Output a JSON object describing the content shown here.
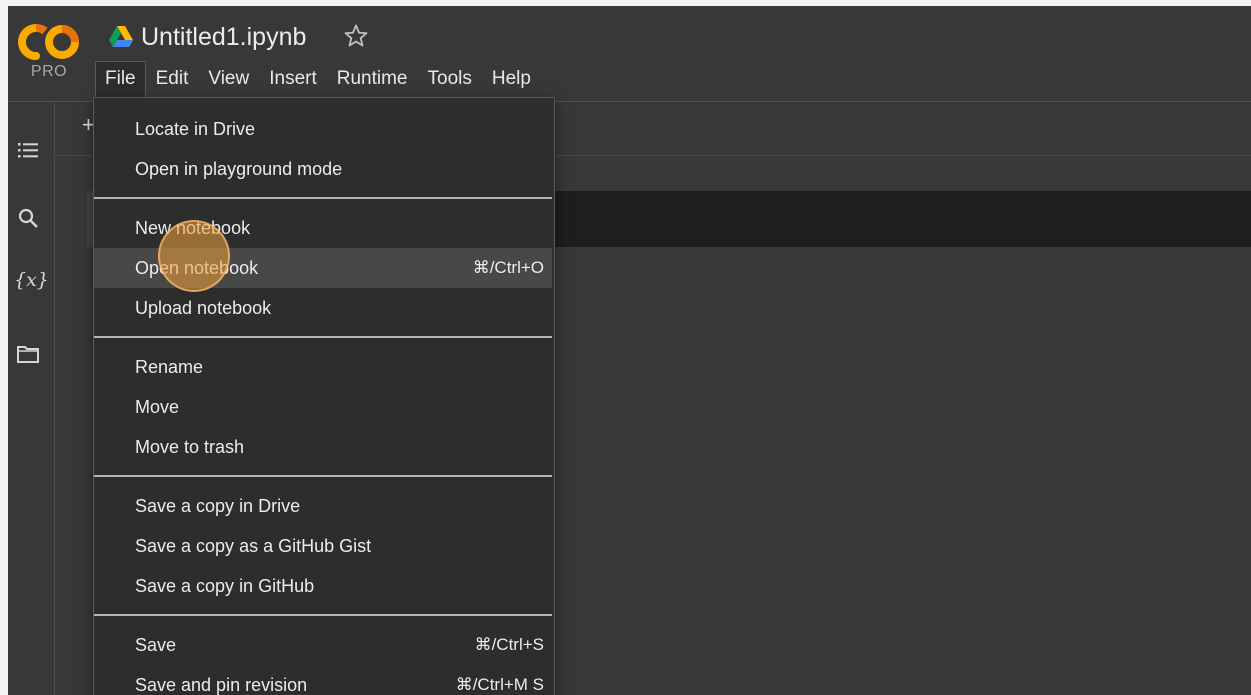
{
  "app": {
    "logo_text": "CO",
    "tier_badge": "PRO",
    "notebook_title": "Untitled1.ipynb"
  },
  "menubar": {
    "items": [
      "File",
      "Edit",
      "View",
      "Insert",
      "Runtime",
      "Tools",
      "Help"
    ],
    "active": "File"
  },
  "rail": {
    "variables_label": "{x}"
  },
  "toolbar": {
    "add_label": "+"
  },
  "file_menu": {
    "groups": [
      [
        {
          "label": "Locate in Drive",
          "shortcut": ""
        },
        {
          "label": "Open in playground mode",
          "shortcut": ""
        }
      ],
      [
        {
          "label": "New notebook",
          "shortcut": ""
        },
        {
          "label": "Open notebook",
          "shortcut": "⌘/Ctrl+O"
        },
        {
          "label": "Upload notebook",
          "shortcut": ""
        }
      ],
      [
        {
          "label": "Rename",
          "shortcut": ""
        },
        {
          "label": "Move",
          "shortcut": ""
        },
        {
          "label": "Move to trash",
          "shortcut": ""
        }
      ],
      [
        {
          "label": "Save a copy in Drive",
          "shortcut": ""
        },
        {
          "label": "Save a copy as a GitHub Gist",
          "shortcut": ""
        },
        {
          "label": "Save a copy in GitHub",
          "shortcut": ""
        }
      ],
      [
        {
          "label": "Save",
          "shortcut": "⌘/Ctrl+S"
        },
        {
          "label": "Save and pin revision",
          "shortcut": "⌘/Ctrl+M S"
        }
      ]
    ],
    "hovered": "Open notebook"
  },
  "colors": {
    "background": "#383838",
    "menu_bg": "#2d2d2d",
    "logo_orange": "#f9ab00",
    "logo_yellow": "#e8710a",
    "highlight": "#484848"
  }
}
